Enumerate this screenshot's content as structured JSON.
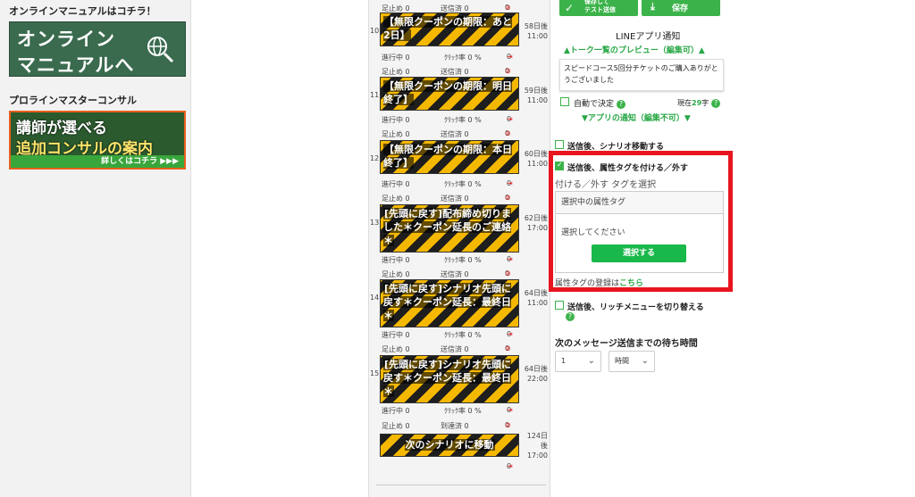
{
  "sidebar": {
    "manual_title": "オンラインマニュアルはコチラ！",
    "manual_banner_line1": "オンライン",
    "manual_banner_line2": "マニュアルへ",
    "consult_title": "プロラインマスターコンサル",
    "consult_banner_line1": "講師が選べる",
    "consult_banner_line2": "追加コンサルの案内",
    "consult_banner_more": "詳しくはコチラ ▶▶▶"
  },
  "scenario": {
    "top_stat": {
      "stop": "足止め 0",
      "sent": "送信済 0",
      "block": "0"
    },
    "steps": [
      {
        "num": "10",
        "title": "【無限クーポンの期限：あと2日】",
        "when": [
          "58日後",
          "11:00"
        ],
        "progress": "進行中 0",
        "click": "ｸﾘｯｸ率 0 %",
        "unsub": "0",
        "stop": "足止め 0",
        "sent": "送信済 0",
        "block": "0"
      },
      {
        "num": "11",
        "title": "【無限クーポンの期限：明日終了】",
        "when": [
          "59日後",
          "11:00"
        ],
        "progress": "進行中 0",
        "click": "ｸﾘｯｸ率 0 %",
        "unsub": "0",
        "stop": "足止め 0",
        "sent": "送信済 0",
        "block": "0"
      },
      {
        "num": "12",
        "title": "【無限クーポンの期限：本日終了】",
        "when": [
          "60日後",
          "11:00"
        ],
        "progress": "進行中 0",
        "click": "ｸﾘｯｸ率 0 %",
        "unsub": "0",
        "stop": "足止め 0",
        "sent": "送信済 0",
        "block": "0"
      },
      {
        "num": "13",
        "title": "[先頭に戻す]配布締め切りました＊クーポン延長のご連絡＊",
        "when": [
          "62日後",
          "17:00"
        ],
        "progress": "進行中 0",
        "click": "ｸﾘｯｸ率 0 %",
        "unsub": "0",
        "stop": "足止め 0",
        "sent": "送信済 0",
        "block": "0"
      },
      {
        "num": "14",
        "title": "[先頭に戻す]シナリオ先頭に戻す＊クーポン延長：最終日＊",
        "when": [
          "64日後",
          "11:00"
        ],
        "progress": "進行中 0",
        "click": "ｸﾘｯｸ率 0 %",
        "unsub": "0",
        "stop": "足止め 0",
        "sent": "送信済 0",
        "block": "0"
      },
      {
        "num": "15",
        "title": "[先頭に戻す]シナリオ先頭に戻す＊クーポン延長：最終日＊",
        "when": [
          "64日後",
          "22:00"
        ],
        "progress": "進行中 0",
        "click": "ｸﾘｯｸ率 0 %",
        "unsub": "0",
        "stop": "足止め 0",
        "sent": "到達済 0",
        "block": "0"
      }
    ],
    "next_scenario": {
      "title": "次のシナリオに移動",
      "when": [
        "124日",
        "後",
        "17:00"
      ],
      "unsub": "0"
    }
  },
  "settings": {
    "save_test_label": "保存して\nテスト送信",
    "save_label": "保存",
    "line_notify_title": "LINEアプリ通知",
    "preview_toggle": "▲トーク一覧のプレビュー（編集可）▲",
    "preview_text": "スピードコース5回分チケットのご購入ありがとうございました",
    "auto_decide": "自動で決定",
    "char_count_prefix": "現在",
    "char_count_value": "29",
    "char_count_suffix": "字",
    "app_notify_toggle": "▼アプリの通知（編集不可）▼",
    "move_scenario": "送信後、シナリオ移動する",
    "attach_tag": "送信後、属性タグを付ける／外す",
    "tag_select_label": "付ける／外す タグを選択",
    "selected_tag_header": "選択中の属性タグ",
    "please_select": "選択してください",
    "select_button": "選択する",
    "tag_register_prefix": "属性タグの登録は",
    "tag_register_link": "こちら",
    "switch_rich_menu": "送信後、リッチメニューを切り替える",
    "wait_title": "次のメッセージ送信までの待ち時間",
    "wait_value": "1",
    "wait_unit": "時間"
  },
  "colors": {
    "accent_green": "#3cb34a",
    "highlight_red": "#e8141e",
    "stripe_yellow": "#f5b800"
  }
}
